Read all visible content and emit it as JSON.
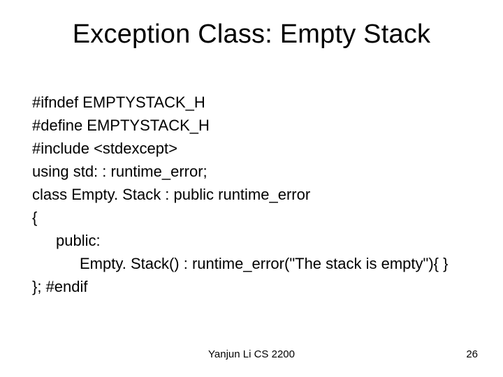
{
  "title": "Exception Class: Empty Stack",
  "code": {
    "l1": "#ifndef EMPTYSTACK_H",
    "l2": "#define EMPTYSTACK_H",
    "l3": "#include <stdexcept>",
    "l4": "using std: : runtime_error;",
    "l5": "class Empty. Stack : public runtime_error",
    "l6": "{",
    "l7": "public:",
    "l8": "Empty. Stack() : runtime_error(\"The stack is empty\"){ }",
    "l9": "}; #endif"
  },
  "footer": {
    "center": "Yanjun Li CS 2200",
    "page": "26"
  }
}
